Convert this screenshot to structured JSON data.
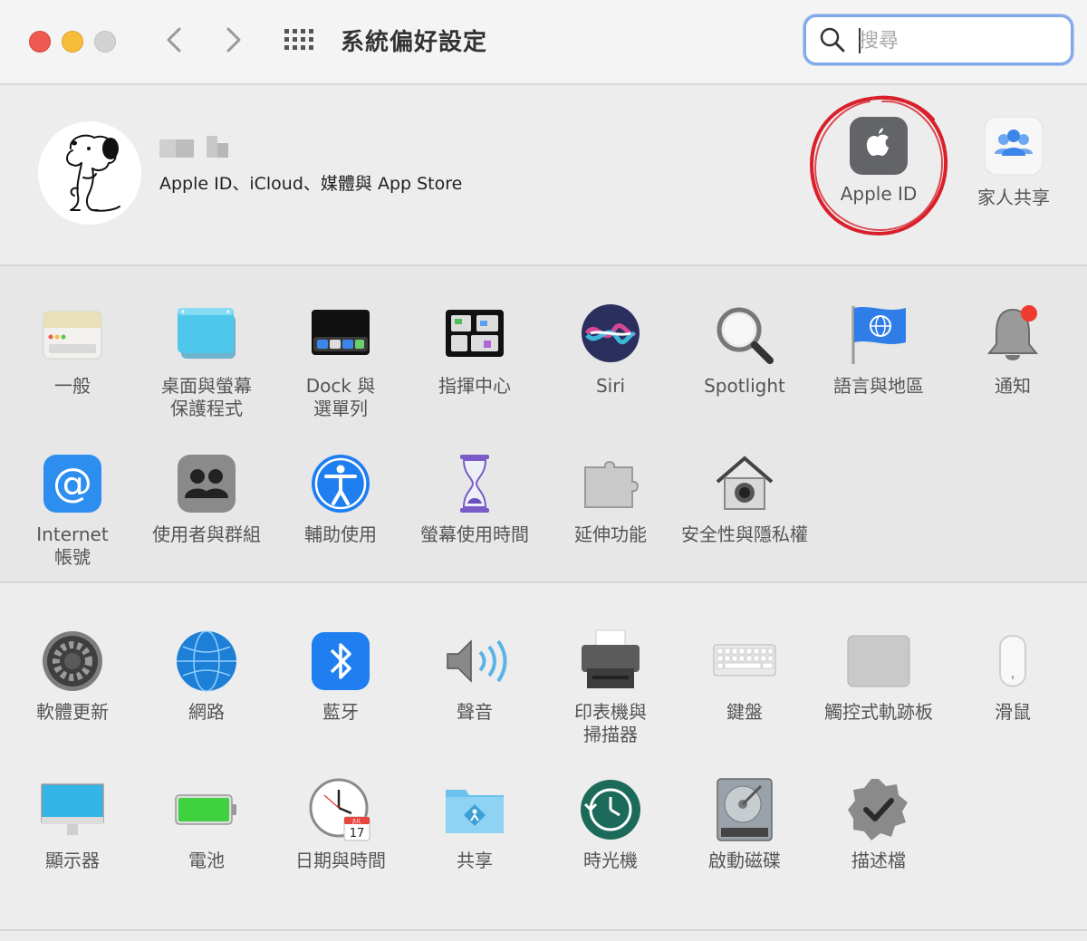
{
  "window": {
    "title": "系統偏好設定"
  },
  "search": {
    "placeholder": "搜尋",
    "value": ""
  },
  "account": {
    "description": "Apple ID、iCloud、媒體與 App Store",
    "apple_id_label": "Apple ID",
    "family_label": "家人共享"
  },
  "section1": {
    "row1": [
      {
        "label": "一般",
        "icon": "general-icon"
      },
      {
        "label": "桌面與螢幕\n保護程式",
        "icon": "desktop-screensaver-icon"
      },
      {
        "label": "Dock 與\n選單列",
        "icon": "dock-icon"
      },
      {
        "label": "指揮中心",
        "icon": "mission-control-icon"
      },
      {
        "label": "Siri",
        "icon": "siri-icon"
      },
      {
        "label": "Spotlight",
        "icon": "spotlight-icon"
      },
      {
        "label": "語言與地區",
        "icon": "flag-icon"
      },
      {
        "label": "通知",
        "icon": "bell-icon"
      }
    ],
    "row2": [
      {
        "label": "Internet\n帳號",
        "icon": "at-icon"
      },
      {
        "label": "使用者與群組",
        "icon": "users-icon"
      },
      {
        "label": "輔助使用",
        "icon": "accessibility-icon"
      },
      {
        "label": "螢幕使用時間",
        "icon": "hourglass-icon"
      },
      {
        "label": "延伸功能",
        "icon": "puzzle-icon"
      },
      {
        "label": "安全性與隱私權",
        "icon": "house-lock-icon"
      }
    ]
  },
  "section2": {
    "row1": [
      {
        "label": "軟體更新",
        "icon": "gear-icon"
      },
      {
        "label": "網路",
        "icon": "globe-icon"
      },
      {
        "label": "藍牙",
        "icon": "bluetooth-icon"
      },
      {
        "label": "聲音",
        "icon": "speaker-icon"
      },
      {
        "label": "印表機與\n掃描器",
        "icon": "printer-icon"
      },
      {
        "label": "鍵盤",
        "icon": "keyboard-icon"
      },
      {
        "label": "觸控式軌跡板",
        "icon": "trackpad-icon"
      },
      {
        "label": "滑鼠",
        "icon": "mouse-icon"
      }
    ],
    "row2": [
      {
        "label": "顯示器",
        "icon": "display-icon"
      },
      {
        "label": "電池",
        "icon": "battery-icon"
      },
      {
        "label": "日期與時間",
        "icon": "clock-icon",
        "calendar_month": "JUL",
        "calendar_day": "17"
      },
      {
        "label": "共享",
        "icon": "sharing-folder-icon"
      },
      {
        "label": "時光機",
        "icon": "time-machine-icon"
      },
      {
        "label": "啟動磁碟",
        "icon": "disk-icon"
      },
      {
        "label": "描述檔",
        "icon": "profile-badge-icon"
      }
    ]
  },
  "colors": {
    "highlight_circle": "#d9202a",
    "search_focus": "#82a9e8"
  }
}
